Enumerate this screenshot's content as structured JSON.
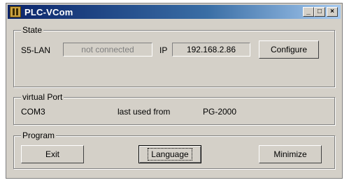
{
  "window": {
    "title": "PLC-VCom",
    "controls": {
      "minimize": "_",
      "maximize": "□",
      "close": "×"
    }
  },
  "state": {
    "legend": "State",
    "interface_label": "S5-LAN",
    "status_value": "not connected",
    "ip_label": "IP",
    "ip_value": "192.168.2.86",
    "configure_button": "Configure"
  },
  "virtual_port": {
    "legend": "virtual Port",
    "port": "COM3",
    "last_used_label": "last used from",
    "last_used_value": "PG-2000"
  },
  "program": {
    "legend": "Program",
    "exit_button": "Exit",
    "language_button": "Language",
    "minimize_button": "Minimize"
  }
}
